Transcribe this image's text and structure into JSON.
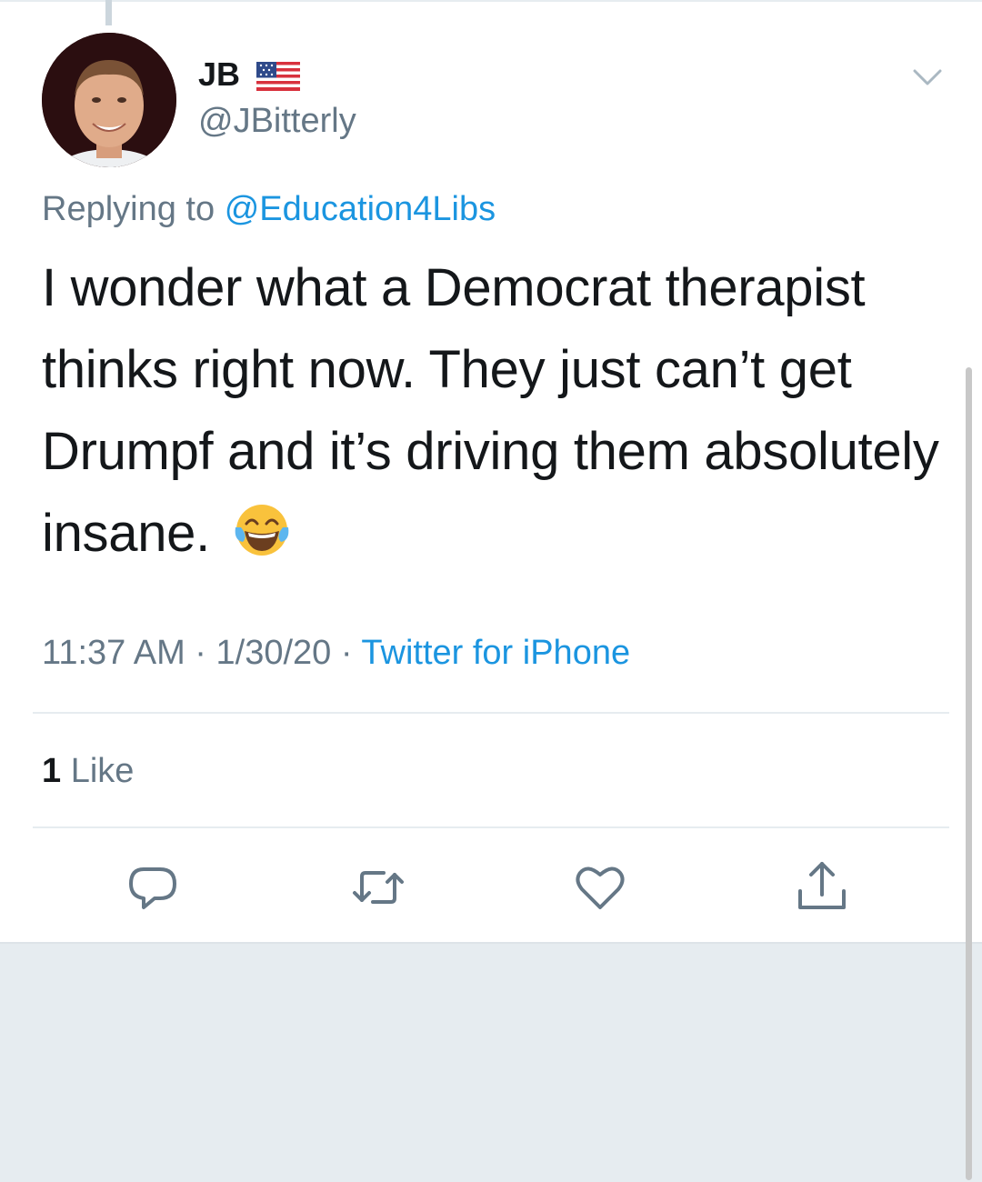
{
  "tweet": {
    "author_name": "JB",
    "author_handle": "@JBitterly",
    "replying_prefix": "Replying to",
    "replying_to": "@Education4Libs",
    "text": "I wonder what a Democrat therapist thinks right now. They just can’t get Drumpf and it’s driving them absolutely insane.",
    "emoji": "face-with-tears-of-joy-icon",
    "time": "11:37 AM",
    "separator": " · ",
    "date": "1/30/20",
    "source": "Twitter for iPhone",
    "like_count": "1",
    "like_label": "Like"
  },
  "icons": {
    "flag": "us-flag-icon",
    "menu": "chevron-down-icon",
    "actions": [
      "reply-icon",
      "retweet-icon",
      "like-icon",
      "share-icon"
    ]
  },
  "colors": {
    "link": "#1b95e0",
    "secondary_text": "#657786",
    "primary_text": "#14171a",
    "divider": "#e6ecf0",
    "background_below": "#e6ecf0"
  }
}
